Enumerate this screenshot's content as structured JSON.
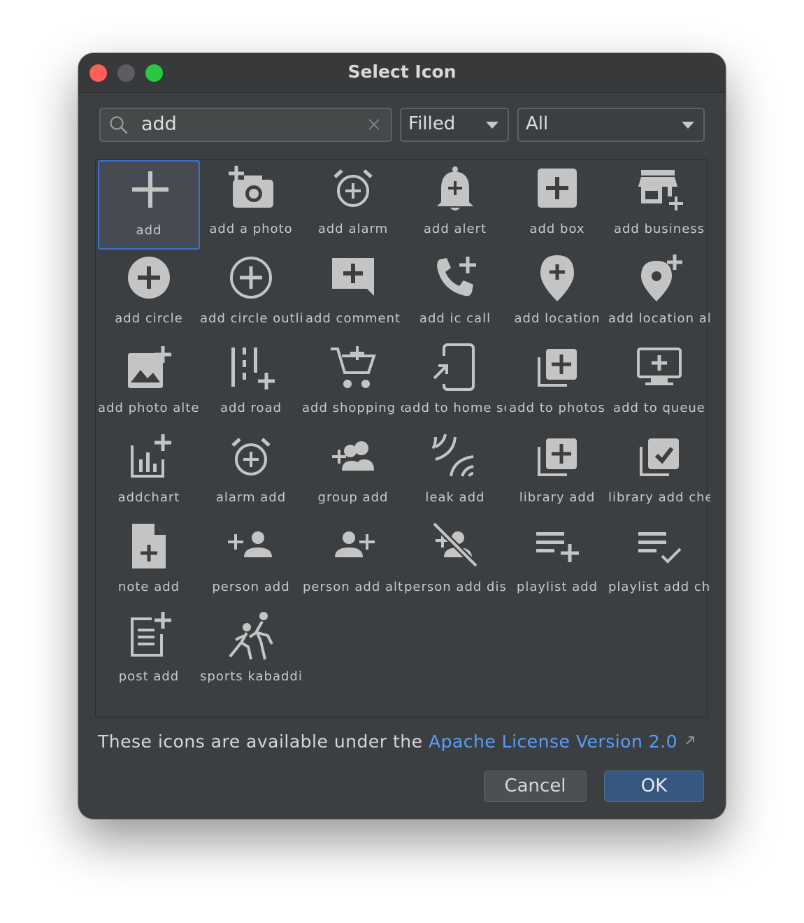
{
  "window": {
    "title": "Select Icon"
  },
  "search": {
    "value": "add",
    "icon": "search-icon"
  },
  "filters": {
    "style_value": "Filled",
    "category_value": "All"
  },
  "icons": [
    {
      "label": "add",
      "icon": "add-icon",
      "selected": true
    },
    {
      "label": "add a photo",
      "icon": "add-a-photo-icon"
    },
    {
      "label": "add alarm",
      "icon": "add-alarm-icon"
    },
    {
      "label": "add alert",
      "icon": "add-alert-icon"
    },
    {
      "label": "add box",
      "icon": "add-box-icon"
    },
    {
      "label": "add business",
      "icon": "add-business-icon"
    },
    {
      "label": "add circle",
      "icon": "add-circle-icon"
    },
    {
      "label": "add circle outli",
      "icon": "add-circle-outline-icon"
    },
    {
      "label": "add comment",
      "icon": "add-comment-icon"
    },
    {
      "label": "add ic call",
      "icon": "add-ic-call-icon"
    },
    {
      "label": "add location",
      "icon": "add-location-icon"
    },
    {
      "label": "add location al",
      "icon": "add-location-alt-icon"
    },
    {
      "label": "add photo alter",
      "icon": "add-photo-alternate-icon"
    },
    {
      "label": "add road",
      "icon": "add-road-icon"
    },
    {
      "label": "add shopping c",
      "icon": "add-shopping-cart-icon"
    },
    {
      "label": "add to home sc",
      "icon": "add-to-home-screen-icon"
    },
    {
      "label": "add to photos",
      "icon": "add-to-photos-icon"
    },
    {
      "label": "add to queue",
      "icon": "add-to-queue-icon"
    },
    {
      "label": "addchart",
      "icon": "addchart-icon"
    },
    {
      "label": "alarm add",
      "icon": "alarm-add-icon"
    },
    {
      "label": "group add",
      "icon": "group-add-icon"
    },
    {
      "label": "leak add",
      "icon": "leak-add-icon"
    },
    {
      "label": "library add",
      "icon": "library-add-icon"
    },
    {
      "label": "library add che",
      "icon": "library-add-check-icon"
    },
    {
      "label": "note add",
      "icon": "note-add-icon"
    },
    {
      "label": "person add",
      "icon": "person-add-icon"
    },
    {
      "label": "person add alt",
      "icon": "person-add-alt-icon"
    },
    {
      "label": "person add dis",
      "icon": "person-add-disabled-icon"
    },
    {
      "label": "playlist add",
      "icon": "playlist-add-icon"
    },
    {
      "label": "playlist add ch",
      "icon": "playlist-add-check-icon"
    },
    {
      "label": "post add",
      "icon": "post-add-icon"
    },
    {
      "label": "sports kabaddi",
      "icon": "sports-kabaddi-icon"
    }
  ],
  "footer": {
    "text": "These icons are available under the",
    "link": "Apache License Version 2.0"
  },
  "buttons": {
    "cancel": "Cancel",
    "ok": "OK"
  },
  "colors": {
    "accent": "#589df6",
    "selection_border": "#3a6fd0",
    "ok_button": "#365880",
    "icon_fill": "#c4c4c4"
  }
}
